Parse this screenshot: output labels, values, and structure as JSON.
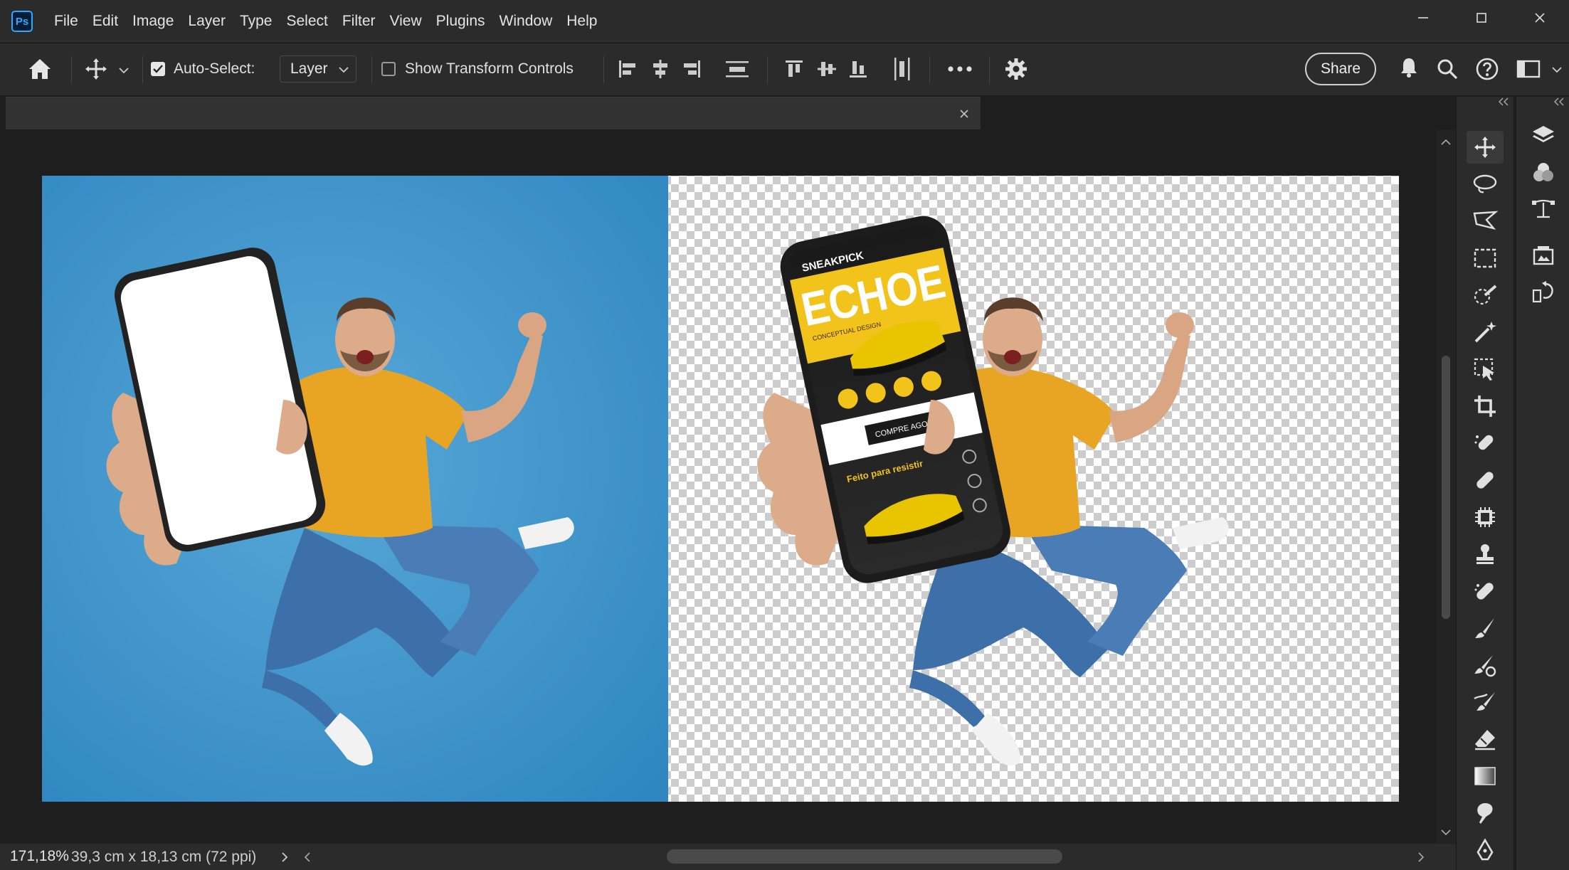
{
  "app": {
    "logo_text": "Ps"
  },
  "menu": [
    "File",
    "Edit",
    "Image",
    "Layer",
    "Type",
    "Select",
    "Filter",
    "View",
    "Plugins",
    "Window",
    "Help"
  ],
  "window_controls": [
    "minimize-icon",
    "maximize-icon",
    "close-icon"
  ],
  "options_bar": {
    "auto_select_label": "Auto-Select:",
    "auto_select_checked": true,
    "layer_select_value": "Layer",
    "show_transform_label": "Show Transform Controls",
    "show_transform_checked": false,
    "share_label": "Share"
  },
  "status_bar": {
    "zoom": "171,18%",
    "doc_info": "39,3 cm x 18,13 cm (72 ppi)"
  },
  "phone_screen": {
    "brand": "SNEAKPICK",
    "headline": "ECHOE",
    "subtitle": "CONCEPTUAL DESIGN",
    "cta": "COMPRE AGORA",
    "tagline": "Feito para resistir"
  },
  "tools": [
    "move-tool",
    "lasso-tool",
    "polygonal-lasso-tool",
    "rectangular-marquee-tool",
    "quick-selection-tool",
    "magic-wand-tool",
    "object-selection-tool",
    "crop-tool",
    "spot-healing-tool",
    "healing-brush-tool",
    "content-aware-tool",
    "clone-stamp-tool",
    "red-eye-tool",
    "brush-tool",
    "color-replacement-tool",
    "mixer-brush-tool",
    "eraser-tool",
    "gradient-tool",
    "smudge-tool",
    "pen-tool"
  ],
  "panels": [
    "layers-panel",
    "channels-panel",
    "paths-panel",
    "libraries-panel",
    "history-panel"
  ],
  "colors": {
    "background_blue": "#3c93c9",
    "shirt_yellow": "#e7a523",
    "jeans_blue": "#3d6fa8"
  }
}
